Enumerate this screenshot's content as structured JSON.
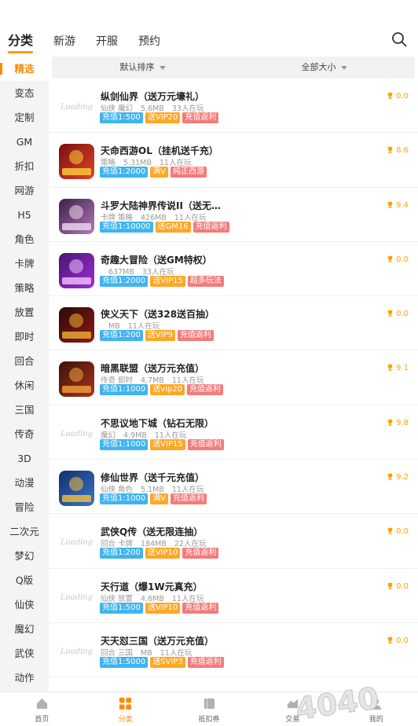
{
  "top_tabs": [
    "分类",
    "新游",
    "开服",
    "预约"
  ],
  "sidebar": [
    "精选",
    "变态",
    "定制",
    "GM",
    "折扣",
    "网游",
    "H5",
    "角色",
    "卡牌",
    "策略",
    "放置",
    "即时",
    "回合",
    "休闲",
    "三国",
    "传奇",
    "3D",
    "动漫",
    "冒险",
    "二次元",
    "梦幻",
    "Q版",
    "仙侠",
    "魔幻",
    "武侠",
    "动作"
  ],
  "filters": {
    "sort": "默认排序",
    "size": "全部大小"
  },
  "games": [
    {
      "name": "纵剑仙界（送万元壕礼）",
      "meta": [
        "仙侠 魔幻",
        "5.6MB",
        "33人在玩"
      ],
      "tags": [
        [
          "充值1:500",
          "blue"
        ],
        [
          "送VIP20",
          "orange"
        ],
        [
          "充值返利",
          "red"
        ]
      ],
      "score": "0.0",
      "icon": "placeholder"
    },
    {
      "name": "天命西游OL（挂机送千充）",
      "meta": [
        "策略",
        "5.31MB",
        "11人在玩"
      ],
      "tags": [
        [
          "充值1:2000",
          "blue"
        ],
        [
          "满V",
          "orange"
        ],
        [
          "纯正西游",
          "red"
        ]
      ],
      "score": "8.6",
      "icon": "red"
    },
    {
      "name": "斗罗大陆神界传说II（送无…",
      "meta": [
        "卡牌 策略",
        "426MB",
        "11人在玩"
      ],
      "tags": [
        [
          "充值1:10000",
          "blue"
        ],
        [
          "送GM16",
          "orange"
        ],
        [
          "充值返利",
          "red"
        ]
      ],
      "score": "9.4",
      "icon": "purple"
    },
    {
      "name": "奇趣大冒险（送GM特权）",
      "meta": [
        "",
        "637MB",
        "33人在玩"
      ],
      "tags": [
        [
          "充值1:2000",
          "blue"
        ],
        [
          "送VIP15",
          "orange"
        ],
        [
          "超多玩法",
          "red"
        ]
      ],
      "score": "0.0",
      "icon": "violet"
    },
    {
      "name": "侠义天下（送328送百抽）",
      "meta": [
        "",
        "MB",
        "11人在玩"
      ],
      "tags": [
        [
          "充值1:200",
          "blue"
        ],
        [
          "送VIP9",
          "orange"
        ],
        [
          "充值返利",
          "red"
        ]
      ],
      "score": "0.0",
      "icon": "darkred"
    },
    {
      "name": "暗黑联盟（送万元充值）",
      "meta": [
        "传奇 即时",
        "4.7MB",
        "11人在玩"
      ],
      "tags": [
        [
          "充值1:1000",
          "blue"
        ],
        [
          "送vip20",
          "orange"
        ],
        [
          "充值返利",
          "red"
        ]
      ],
      "score": "9.1",
      "icon": "brown"
    },
    {
      "name": "不思议地下城（钻石无限）",
      "meta": [
        "魔幻",
        "4.9MB",
        "11人在玩"
      ],
      "tags": [
        [
          "充值1:1000",
          "blue"
        ],
        [
          "送VIP15",
          "orange"
        ],
        [
          "充值返利",
          "red"
        ]
      ],
      "score": "9.8",
      "icon": "placeholder"
    },
    {
      "name": "修仙世界（送千元充值）",
      "meta": [
        "仙侠 角色",
        "5.1MB",
        "11人在玩"
      ],
      "tags": [
        [
          "充值1:1000",
          "blue"
        ],
        [
          "满V",
          "orange"
        ],
        [
          "充值返利",
          "red"
        ]
      ],
      "score": "9.2",
      "icon": "blue"
    },
    {
      "name": "武侠Q传（送无限连抽）",
      "meta": [
        "回合 卡牌",
        "184MB",
        "22人在玩"
      ],
      "tags": [
        [
          "充值1:200",
          "blue"
        ],
        [
          "送VIP10",
          "orange"
        ],
        [
          "充值返利",
          "red"
        ]
      ],
      "score": "0.0",
      "icon": "placeholder"
    },
    {
      "name": "天行道（爆1W元真充）",
      "meta": [
        "仙侠 放置",
        "4.6MB",
        "11人在玩"
      ],
      "tags": [
        [
          "充值1:500",
          "blue"
        ],
        [
          "送VIP10",
          "orange"
        ],
        [
          "充值返利",
          "red"
        ]
      ],
      "score": "0.0",
      "icon": "placeholder"
    },
    {
      "name": "天天怼三国（送万元充值）",
      "meta": [
        "回合 三国",
        "MB",
        "11人在玩"
      ],
      "tags": [
        [
          "充值1:5000",
          "blue"
        ],
        [
          "送SVIP3",
          "orange"
        ],
        [
          "充值返利",
          "red"
        ]
      ],
      "score": "0.0",
      "icon": "placeholder"
    }
  ],
  "placeholder_text": "Loading",
  "bottom_nav": [
    "首页",
    "分类",
    "抵扣券",
    "交易",
    "我的"
  ],
  "watermark": "4040"
}
